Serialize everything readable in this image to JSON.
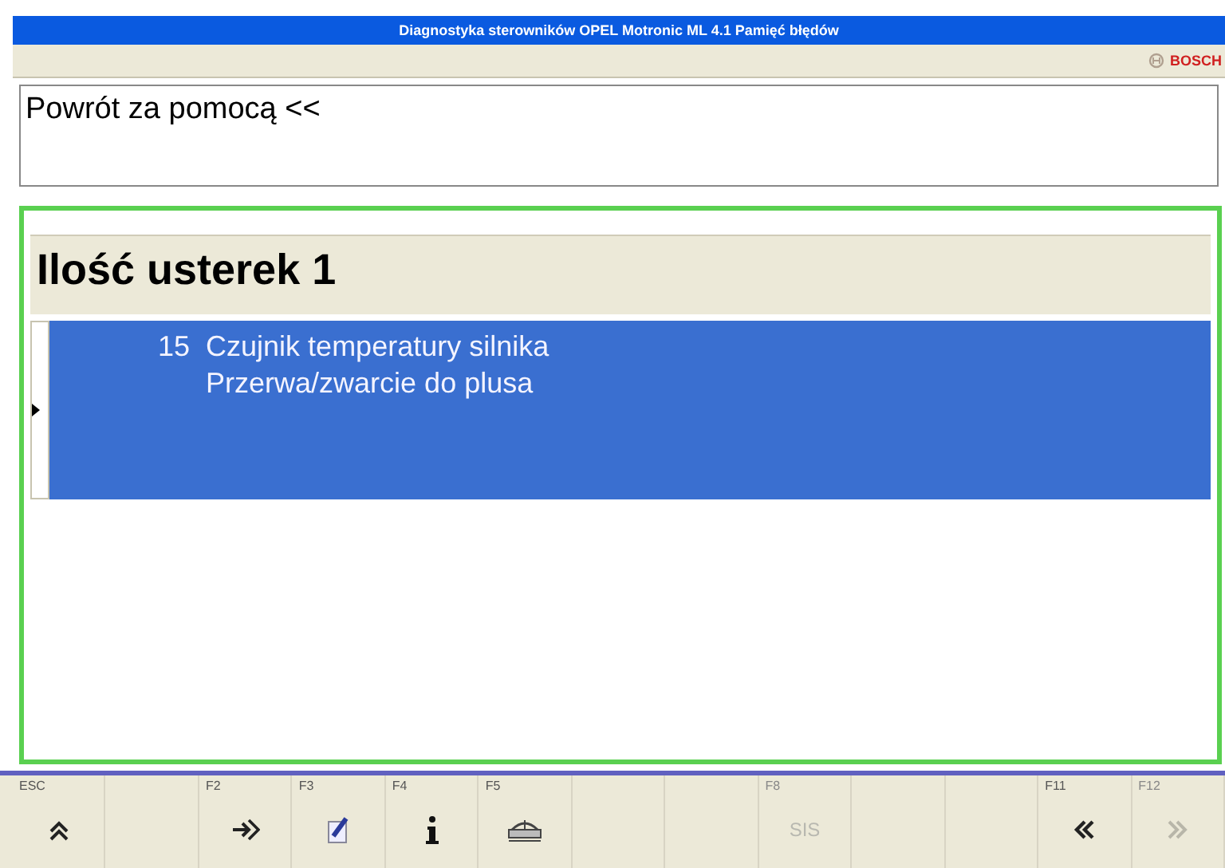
{
  "window": {
    "title": "Diagnostyka sterowników  OPEL  Motronic ML 4.1  Pamięć błędów"
  },
  "brand": "BOSCH",
  "message": "Powrót za pomocą <<",
  "faults": {
    "heading": "Ilość usterek 1",
    "rows": [
      {
        "code": "15",
        "lines": [
          "Czujnik temperatury silnika",
          "Przerwa/zwarcie do plusa"
        ],
        "selected": true
      }
    ]
  },
  "keys": [
    {
      "key": "ESC",
      "kind": "up",
      "disabled": false
    },
    {
      "kind": "blank"
    },
    {
      "key": "F2",
      "kind": "enter",
      "disabled": false
    },
    {
      "key": "F3",
      "kind": "edit",
      "disabled": false
    },
    {
      "key": "F4",
      "kind": "info",
      "disabled": false
    },
    {
      "key": "F5",
      "kind": "printer",
      "disabled": false
    },
    {
      "kind": "blank"
    },
    {
      "kind": "blank"
    },
    {
      "key": "F8",
      "kind": "text",
      "text": "SIS",
      "disabled": true
    },
    {
      "kind": "blank"
    },
    {
      "kind": "blank"
    },
    {
      "key": "F11",
      "kind": "back",
      "disabled": false
    },
    {
      "key": "F12",
      "kind": "forward",
      "disabled": true
    }
  ]
}
